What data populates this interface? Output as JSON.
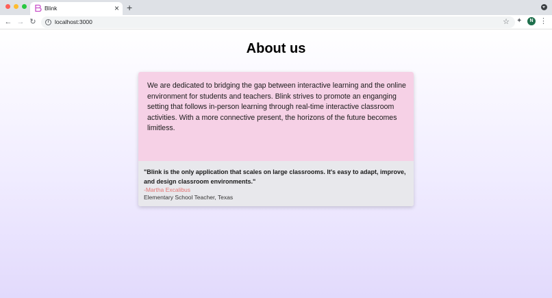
{
  "browser": {
    "tab_title": "Blink",
    "tab_close": "×",
    "new_tab": "+",
    "url": "localhost:3000",
    "avatar_initial": "N",
    "icons": {
      "back": "←",
      "forward": "→",
      "reload": "↻",
      "info": "i",
      "star": "☆",
      "extensions": "✦",
      "menu": "⋮"
    }
  },
  "page": {
    "title": "About us",
    "description": "We are dedicated to bridging the gap between interactive learning and the online environment for students and teachers. Blink strives to promote an enganging setting that follows in-person learning through real-time interactive classroom activities. With a more connective present, the horizons of the future becomes limitless.",
    "testimonial": {
      "quote": "\"Blink is the only application that scales on large classrooms. It's easy to adapt, improve, and design classroom environments.\"",
      "author": "-Martha Excalibus",
      "role": "Elementary School Teacher, Texas"
    }
  },
  "colors": {
    "card_top": "#f6d1e6",
    "card_bottom": "#e8e8ec",
    "author": "#e57373",
    "brand": "#c84fc9"
  }
}
